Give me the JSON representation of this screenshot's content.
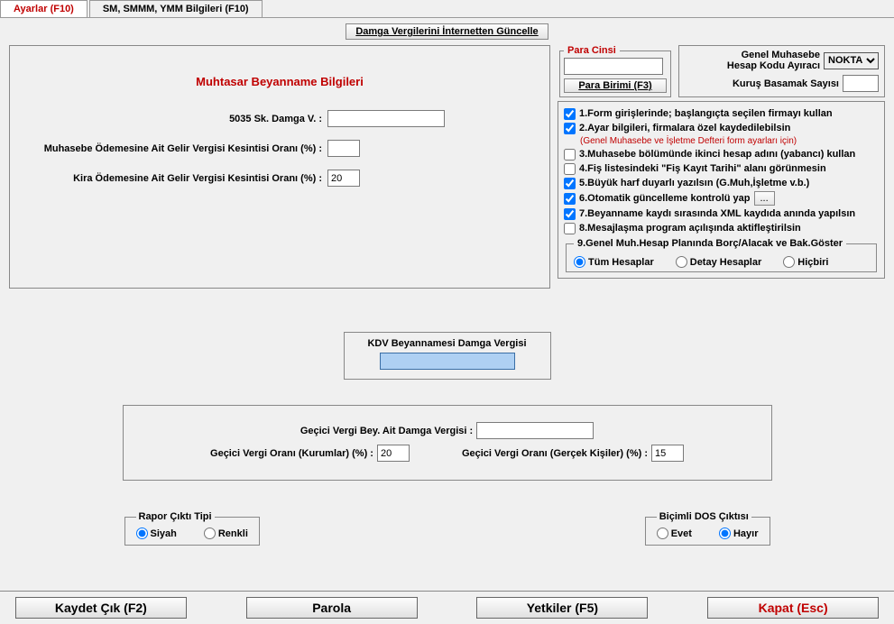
{
  "tabs": {
    "ayarlar": "Ayarlar (F10)",
    "sm": "SM, SMMM, YMM Bilgileri (F10)"
  },
  "buttons": {
    "damga_guncelle": "Damga Vergilerini İnternetten Güncelle",
    "para_birimi": "Para Birimi (F3)",
    "ellipsis": "...",
    "kaydet": "Kaydet Çık (F2)",
    "parola": "Parola",
    "yetkiler": "Yetkiler (F5)",
    "kapat": "Kapat (Esc)"
  },
  "muhtasar": {
    "title": "Muhtasar Beyanname Bilgileri",
    "l1": "5035 Sk. Damga V. :",
    "v1": "",
    "l2": "Muhasebe Ödemesine Ait Gelir Vergisi Kesintisi Oranı (%) :",
    "v2": "",
    "l3": "Kira Ödemesine Ait Gelir Vergisi Kesintisi Oranı (%) :",
    "v3": "20"
  },
  "para_cinsi": {
    "legend": "Para Cinsi",
    "value": ""
  },
  "gmuh": {
    "l1": "Genel Muhasebe",
    "l2": "Hesap Kodu Ayıracı",
    "sel": "NOKTA",
    "kurus_label": "Kuruş Basamak Sayısı",
    "kurus": ""
  },
  "opts": {
    "o1": "1.Form girişlerinde; başlangıçta seçilen firmayı kullan",
    "o2": "2.Ayar bilgileri, firmalara özel kaydedilebilsin",
    "o2n": "(Genel Muhasebe ve İşletme Defteri form ayarları için)",
    "o3": "3.Muhasebe bölümünde ikinci hesap adını (yabancı) kullan",
    "o4": "4.Fiş listesindeki \"Fiş Kayıt Tarihi\" alanı görünmesin",
    "o5": "5.Büyük harf duyarlı yazılsın (G.Muh,İşletme v.b.)",
    "o6": "6.Otomatik güncelleme kontrolü yap",
    "o7": "7.Beyanname kaydı sırasında XML kaydıda anında yapılsın",
    "o8": "8.Mesajlaşma program açılışında aktifleştirilsin",
    "fs9": "9.Genel Muh.Hesap Planında Borç/Alacak ve Bak.Göster",
    "r9a": "Tüm Hesaplar",
    "r9b": "Detay Hesaplar",
    "r9c": "Hiçbiri"
  },
  "opts_state": {
    "o1": true,
    "o2": true,
    "o3": false,
    "o4": false,
    "o5": true,
    "o6": true,
    "o7": true,
    "o8": false,
    "r9": "a"
  },
  "kdv": {
    "label": "KDV Beyannamesi  Damga Vergisi",
    "value": ""
  },
  "gecici": {
    "l1": "Geçici Vergi Bey. Ait Damga Vergisi :",
    "v1": "",
    "l2": "Geçici Vergi Oranı (Kurumlar) (%) :",
    "v2": "20",
    "l3": "Geçici Vergi Oranı (Gerçek Kişiler) (%) :",
    "v3": "15"
  },
  "rapor": {
    "legend": "Rapor Çıktı Tipi",
    "a": "Siyah",
    "b": "Renkli",
    "sel": "a"
  },
  "dos": {
    "legend": "Biçimli DOS Çıktısı",
    "a": "Evet",
    "b": "Hayır",
    "sel": "b"
  }
}
